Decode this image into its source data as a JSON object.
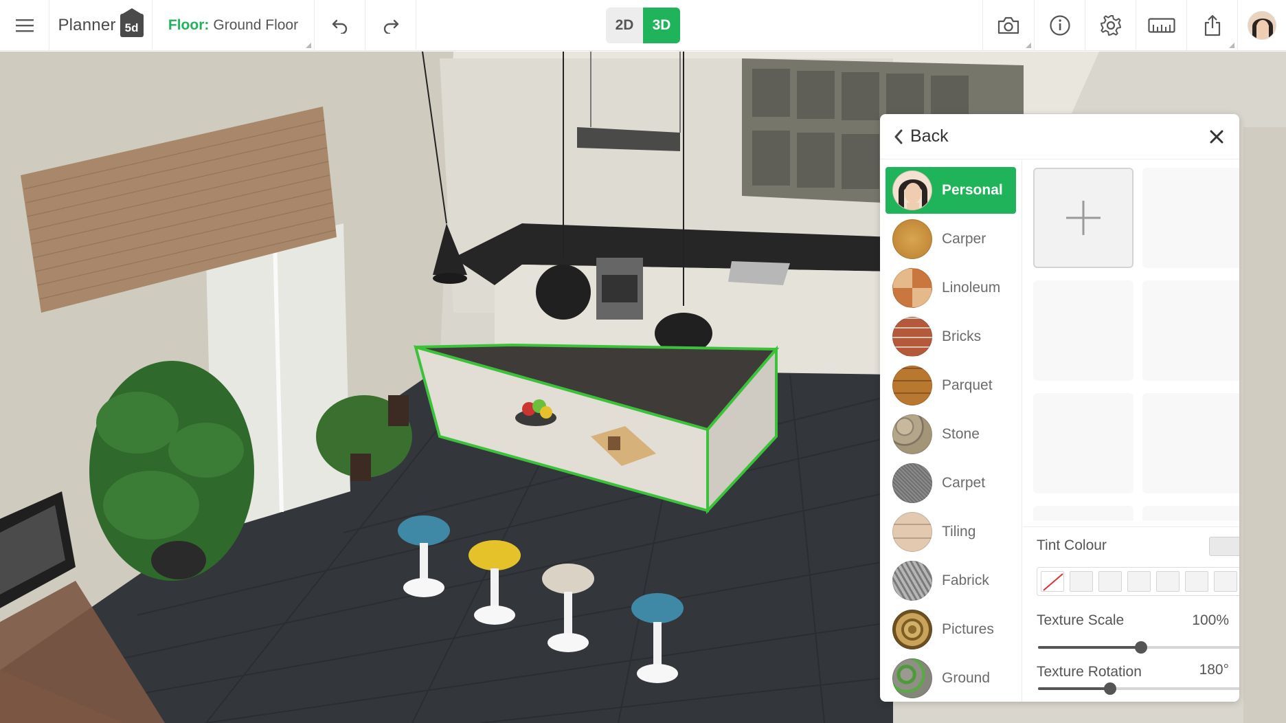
{
  "app": {
    "logo_text": "Planner",
    "logo_badge": "5d"
  },
  "toolbar": {
    "floor_label": "Floor:",
    "floor_value": "Ground Floor",
    "view_2d": "2D",
    "view_3d": "3D",
    "active_view": "3D",
    "icons": [
      "menu-icon",
      "undo-icon",
      "redo-icon",
      "camera-icon",
      "info-icon",
      "gear-icon",
      "ruler-icon",
      "share-icon"
    ]
  },
  "panel": {
    "back_label": "Back",
    "categories": [
      {
        "label": "Personal",
        "active": true
      },
      {
        "label": "Carper",
        "active": false
      },
      {
        "label": "Linoleum",
        "active": false
      },
      {
        "label": "Bricks",
        "active": false
      },
      {
        "label": "Parquet",
        "active": false
      },
      {
        "label": "Stone",
        "active": false
      },
      {
        "label": "Carpet",
        "active": false
      },
      {
        "label": "Tiling",
        "active": false
      },
      {
        "label": "Fabrick",
        "active": false
      },
      {
        "label": "Pictures",
        "active": false
      },
      {
        "label": "Ground",
        "active": false
      }
    ],
    "tint_label": "Tint Colour",
    "scale_label": "Texture Scale",
    "scale_value": "100%",
    "scale_fraction": 0.5,
    "rotation_label": "Texture Rotation",
    "rotation_value": "180°",
    "rotation_fraction": 0.35
  },
  "colors": {
    "accent": "#1fb45a",
    "selection_outline": "#3cc23a"
  }
}
